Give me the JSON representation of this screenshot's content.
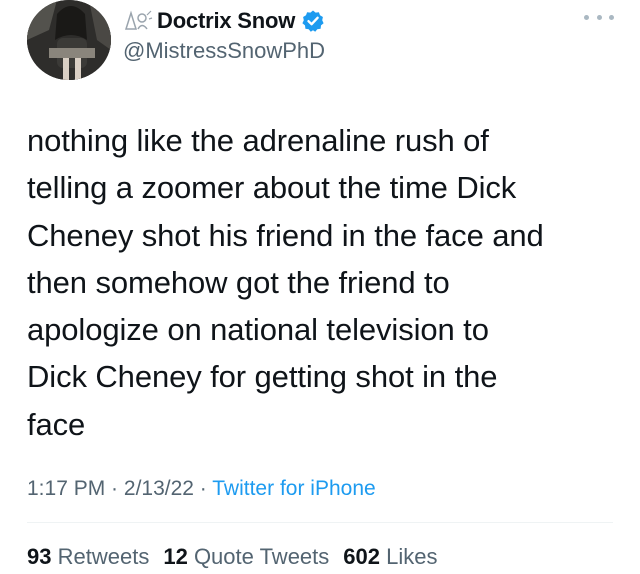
{
  "author": {
    "display_name": "Doctrix Snow",
    "handle": "@MistressSnowPhD",
    "verified": true
  },
  "tweet": {
    "lines": [
      "nothing like the adrenaline rush of",
      "telling a zoomer about the time Dick",
      "Cheney shot his friend in the face and",
      "then somehow got the friend to",
      "apologize on national television to",
      "Dick Cheney for getting shot in the",
      "face"
    ]
  },
  "meta": {
    "time": "1:17 PM",
    "sep1": " · ",
    "date": "2/13/22",
    "sep2": " · ",
    "source": "Twitter for iPhone"
  },
  "stats": {
    "retweets_count": "93",
    "retweets_label": "Retweets",
    "quotes_count": "12",
    "quotes_label": "Quote Tweets",
    "likes_count": "602",
    "likes_label": "Likes"
  },
  "colors": {
    "text": "#0f1419",
    "secondary": "#536471",
    "link": "#1d9bf0",
    "verified": "#1d9bf0"
  },
  "icons": [
    "avatar",
    "flair-icon",
    "verified-badge-icon",
    "more-options-icon"
  ]
}
